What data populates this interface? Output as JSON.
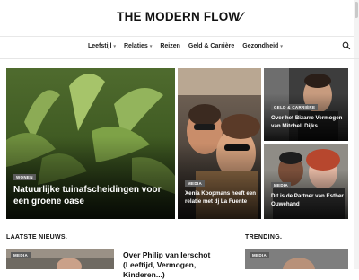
{
  "brand": {
    "logo_text": "THE MODERN FLOW"
  },
  "nav": {
    "items": [
      {
        "label": "Leefstijl",
        "has_menu": true
      },
      {
        "label": "Relaties",
        "has_menu": true
      },
      {
        "label": "Reizen",
        "has_menu": false
      },
      {
        "label": "Geld & Carrière",
        "has_menu": false
      },
      {
        "label": "Gezondheid",
        "has_menu": true
      }
    ],
    "search_icon": "search-icon"
  },
  "featured": [
    {
      "badge": "WONEN",
      "title": "Natuurlijke tuinafscheidingen voor een groene oase"
    },
    {
      "badge": "MEDIA",
      "title": "Xenia Koopmans heeft een relatie met dj La Fuente"
    },
    {
      "badge": "GELD & CARRIÈRE",
      "title": "Over het Bizarre Vermogen van Mitchell Dijks"
    },
    {
      "badge": "MEDIA",
      "title": "Dit is de Partner van Esther Ouwehand"
    }
  ],
  "latest": {
    "label": "LAATSTE NIEUWS.",
    "card": {
      "badge": "MEDIA",
      "title": "Over Philip van Ierschot (Leeftijd, Vermogen, Kinderen...)"
    }
  },
  "trending": {
    "label": "TRENDING.",
    "card": {
      "badge": "MEDIA"
    }
  },
  "colors": {
    "badge_bg": "#5b5b5b",
    "text": "#111111",
    "accent_red": "#d43a2f"
  }
}
